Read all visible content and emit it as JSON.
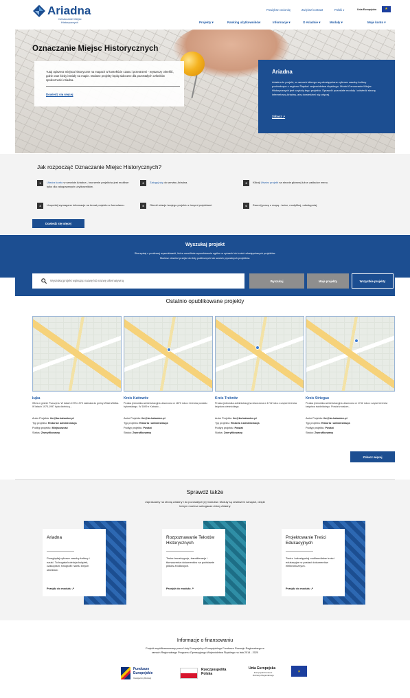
{
  "logo": {
    "name": "Ariadna",
    "sub1": "Oznaczanie Miejsc",
    "sub2": "Historycznych"
  },
  "topbar": {
    "links": [
      "Powiększ czcionkę",
      "Zwiększ kontrast",
      "Polski ▾"
    ],
    "eu_label": "Unia Europejska"
  },
  "nav": [
    "Projekty ▾",
    "Ranking użytkowników",
    "Informacje ▾",
    "O Ariadnie ▾",
    "Moduły ▾",
    "Moje konto ▾"
  ],
  "hero": {
    "title": "Oznaczanie Miejsc Historycznych",
    "text": "Tutaj opiszesz miejsca historyczne na mapach w kontekście czasu i przestrzeni - wystarczy określić, gdzie oraz kiedy istniały na mapie. Dodane projekty będą widoczne dla pozostałych członków społeczności Ariadna.",
    "more": "Dowiedz się więcej",
    "card_title": "Ariadna",
    "card_text": "Ariadna to projekt, w ramach którego są udostępniane cyfrowe zasoby kultury pochodzące z regionu Śląska i województwa śląskiego. Moduł Oznaczanie Miejsc Historycznych jest częścią tego projektu. Sprawdź pozostałe moduły i odwiedź stronę internetową Ariadny, aby dowiedzieć się więcej.",
    "card_link": "Zobacz ↗"
  },
  "steps": {
    "title": "Jak rozpocząć Oznaczanie Miejsc Historycznych?",
    "items": [
      {
        "n": "1",
        "link": "Utwórz konto",
        "text": " w serwisie Ariadna - tworzenie projektów jest możliwe tylko dla zalogowanych użytkowników."
      },
      {
        "n": "2",
        "link": "Zaloguj się",
        "text": " do serwisu Ariadna."
      },
      {
        "n": "3",
        "pre": "Kliknij ",
        "link": "Utwórz projekt",
        "text": " na stronie głównej lub w zakładce menu."
      },
      {
        "n": "4",
        "text": "Uzupełnij wymagane informacje na temat projektu w formularzu."
      },
      {
        "n": "5",
        "text": "Określ relacje twojego projektu z innymi projektami."
      },
      {
        "n": "6",
        "text": "Zacznij pracę z mapą - twórz, modyfikuj, udostępniaj."
      }
    ],
    "button": "Dowiedz się więcej"
  },
  "search": {
    "title": "Wyszukaj projekt",
    "desc1": "Skorzystaj z poniższej wyszukiwarki, która umożliwia wyszukiwanie ogólne w opisach lub treści udostępnianych projektów.",
    "desc2": "Możesz również przejść do listy publicznych lub swoich prywatnych projektów.",
    "placeholder": "Wyszukaj projekt wpisując nazwę lub nazwę alternatywną",
    "btn_search": "Wyszukaj",
    "btn_mine": "Moje projekty",
    "btn_all": "Wszystkie projekty"
  },
  "recent": {
    "title": "Ostatnio opublikowane projekty",
    "more": "Zobacz więcej",
    "cards": [
      {
        "title": "Łąka",
        "desc": "Wieś w gminie Pszczyna. W latach 1975-1975 należała do gminy Wisła Wielka. W latach 1975-1997 była dzielnicą...",
        "author_k": "Autor Projektu: ",
        "author": "ibr@bs.katowice.pl",
        "type_k": "Typ projektu: ",
        "type": "Historia i administracja",
        "sub_k": "Podtyp projektu: ",
        "sub": "Miejscowość",
        "status_k": "Status: ",
        "status": "Zweryfikowany"
      },
      {
        "title": "Kreis Kattowitz",
        "desc": "Pruska jednostka administracyjna utworzona w 1873 roku z terenów powiatu bytomskiego. W 1899 z Katowic...",
        "author_k": "Autor Projektu: ",
        "author": "ibr@bs.katowice.pl",
        "type_k": "Typ projektu: ",
        "type": "Historia i administracja",
        "sub_k": "Podtyp projektu: ",
        "sub": "Powiat",
        "status_k": "Status: ",
        "status": "Zweryfikowany"
      },
      {
        "title": "Kreis Trebnitz",
        "desc": "Pruska jednostka administracyjna utworzona w 1742 roku z części terenów księstwa oleśnickiego.",
        "author_k": "Autor Projektu: ",
        "author": "ibr@bs.katowice.pl",
        "type_k": "Typ projektu: ",
        "type": "Historia i administracja",
        "sub_k": "Podtyp projektu: ",
        "sub": "Powiat",
        "status_k": "Status: ",
        "status": "Zweryfikowany"
      },
      {
        "title": "Kreis Striegau",
        "desc": "Pruska jednostka administracyjna utworzona w 1742 roku z części terenów księstwa świdnickiego. Powiat znosiom...",
        "author_k": "Autor Projektu: ",
        "author": "ibr@bs.katowice.pl",
        "type_k": "Typ projektu: ",
        "type": "Historia i administracja",
        "sub_k": "Podtyp projektu: ",
        "sub": "Powiat",
        "status_k": "Status: ",
        "status": "Zweryfikowany"
      }
    ]
  },
  "also": {
    "title": "Sprawdź także",
    "desc1": "Zapraszamy na stronę Ariadny i do pozostałych jej modułów. Moduły są zestawem narzędzi, dzięki",
    "desc2": "którym możesz wzbogacać zbiory Ariadny",
    "cards": [
      {
        "title": "Ariadna",
        "text": "Przeglądaj cyfrowe zasoby kultury i nauki. To bogata kolekcja książek, czasopism, fotografii i wielu innych obiektów.",
        "link": "Przejdź do modułu ↗"
      },
      {
        "title": "Rozpoznawanie Tekstów Historycznych",
        "text": "Twórz transkrypcje, transliteracje i tłumaczenia dokumentów na podstawie plików źródłowych.",
        "link": "Przejdź do modułu ↗"
      },
      {
        "title": "Projektowanie Treści Edukacyjnych",
        "text": "Twórz i udostępniaj multimedialne treści edukacyjne w postaci dokumentów elektronicznych.",
        "link": "Przejdź do modułu ↗"
      }
    ]
  },
  "funding": {
    "title": "Informacje o finansowaniu",
    "text1": "Projekt współfinansowany przez Unię Europejską z Europejskiego Funduszu Rozwoju Regionalnego w",
    "text2": "ramach Regionalnego Programu Operacyjnego Województwa Śląskiego na lata 2014 - 2020",
    "logo1": "Fundusze Europejskie",
    "logo1_sub": "Inteligentny Rozwój",
    "logo2": "Rzeczpospolita Polska",
    "logo3": "Unia Europejska",
    "logo3_sub1": "Europejski Fundusz",
    "logo3_sub2": "Rozwoju Regionalnego"
  },
  "colors": {
    "navy": "#1c4e91",
    "link": "#1f5aa6"
  }
}
